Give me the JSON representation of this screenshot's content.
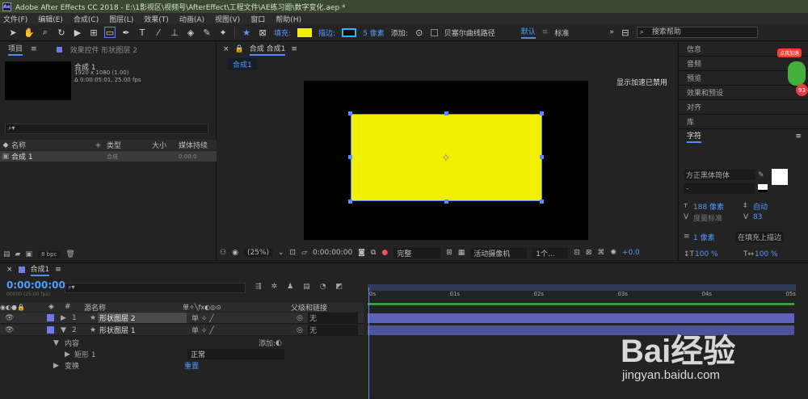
{
  "window": {
    "title": "Adobe After Effects CC 2018 - E:\\1影视区\\视频号\\AfterEffect\\工程文件\\AE练习题\\数字变化.aep *",
    "logo": "Ae"
  },
  "menu": [
    "文件(F)",
    "编辑(E)",
    "合成(C)",
    "图层(L)",
    "效果(T)",
    "动画(A)",
    "视图(V)",
    "窗口",
    "帮助(H)"
  ],
  "toolbar": {
    "fill_label": "填充:",
    "stroke_label": "描边:",
    "stroke_size": "5 像素",
    "add_label": "添加:",
    "bezier_label": "贝塞尔曲线路径",
    "workspace_default": "默认",
    "workspace_standard": "标准",
    "search_placeholder": "搜索帮助",
    "fill_color": "#f0f000",
    "stroke_color": "#29b6ff"
  },
  "project": {
    "tab_project": "项目",
    "tab_effects": "效果控件 形状图层 2",
    "comp_name": "合成 1",
    "comp_size": "1920 x 1080 (1.00)",
    "comp_duration": "Δ 0:00:05:01, 25.00 fps",
    "search_placeholder": "",
    "columns": [
      "名称",
      "类型",
      "大小",
      "媒体持续"
    ],
    "items": [
      {
        "name": "合成 1",
        "type": "合成",
        "duration": "0:00:0"
      }
    ],
    "bpc": "8 bpc"
  },
  "viewer": {
    "tab_label": "合成 合成1",
    "flow_tab": "合成1",
    "gpu_notice": "显示加速已禁用",
    "zoom": "(25%)",
    "timecode": "0:00:00:00",
    "quality": "完整",
    "camera": "活动摄像机",
    "views": "1个...",
    "exposure": "+0.0",
    "shape_color": "#f0f000"
  },
  "right_panel": {
    "sections": [
      "信息",
      "音频",
      "预览",
      "效果和预设",
      "对齐",
      "库"
    ],
    "char_title": "字符",
    "font": "方正黑体简体",
    "style": "-",
    "size": "188 像素",
    "leading": "自动",
    "kerning": "度量标准",
    "tracking": "83",
    "stroke_width": "1 像素",
    "stroke_mode": "在填充上描边",
    "vscale": "100 %",
    "hscale": "100 %"
  },
  "timeline": {
    "tab": "合成1",
    "timecode": "0:00:00:00",
    "frame_info": "00000 (25.00 fps)",
    "col_source": "源名称",
    "col_parent": "父级和链接",
    "ruler": [
      "0s",
      "01s",
      "02s",
      "03s",
      "04s",
      "05s"
    ],
    "layers": [
      {
        "num": "1",
        "name": "形状图层 2",
        "parent": "无"
      },
      {
        "num": "2",
        "name": "形状图层 1",
        "parent": "无"
      }
    ],
    "contents_label": "内容",
    "add_label": "添加:",
    "rect_label": "矩形 1",
    "blend_mode": "正常",
    "transform_label": "变换",
    "reset_label": "重置"
  },
  "watermark": {
    "brand": "Bai经验",
    "url": "jingyan.baidu.com"
  },
  "badge": {
    "text": "点我加速",
    "count": "93"
  }
}
